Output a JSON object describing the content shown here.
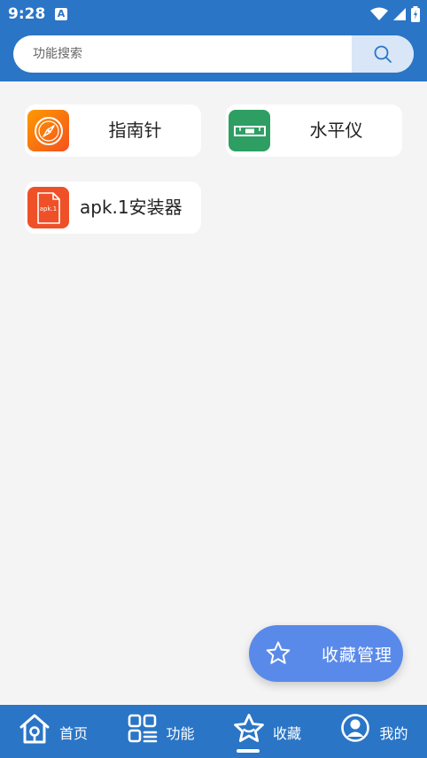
{
  "status_bar": {
    "time": "9:28",
    "notification_badge": "A"
  },
  "search": {
    "placeholder": "功能搜索",
    "value": ""
  },
  "cards": [
    {
      "label": "指南针",
      "icon": "compass-icon",
      "color": "#f57c00"
    },
    {
      "label": "水平仪",
      "icon": "level-icon",
      "color": "#2e9e63"
    },
    {
      "label": "apk.1安装器",
      "icon": "apk-file-icon",
      "icon_text": "apk.1",
      "color": "#ef5027"
    }
  ],
  "fab": {
    "label": "收藏管理",
    "icon": "star-icon"
  },
  "nav": [
    {
      "label": "首页",
      "icon": "home-icon"
    },
    {
      "label": "功能",
      "icon": "grid-icon"
    },
    {
      "label": "收藏",
      "icon": "star-icon",
      "active": true
    },
    {
      "label": "我的",
      "icon": "user-icon"
    }
  ],
  "colors": {
    "primary": "#2a75c6",
    "fab": "#5a8ae9",
    "background": "#f4f4f4"
  }
}
